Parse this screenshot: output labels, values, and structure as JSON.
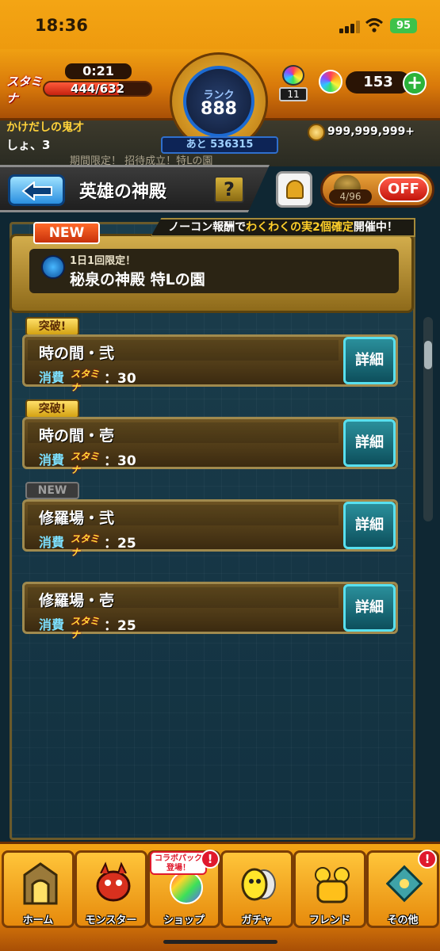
{
  "status_bar": {
    "time": "18:36",
    "battery": "95"
  },
  "hud": {
    "stamina_icon_label": "スタミナ",
    "stamina_timer": "0:21",
    "stamina_value": "444/632",
    "stamina_fraction": 0.7,
    "rank_label": "ランク",
    "rank_value": "888",
    "next_rank": "あと 536315",
    "small_orb_count": "11",
    "orb_count": "153",
    "add_symbol": "+"
  },
  "background_info": {
    "user_name": "かけだしの鬼才",
    "user_name_line2": "しょ、3",
    "coins": "999,999,999+",
    "ghost_text": "期間限定！ 招待成立！特Lの園"
  },
  "header": {
    "title": "英雄の神殿",
    "help_label": "?",
    "toggle_count": "4/96",
    "off_label": "OFF"
  },
  "event_ribbon": {
    "prefix": "ノーコン報酬で",
    "highlight": "わくわくの実2個確定",
    "suffix": "開催中！"
  },
  "featured": {
    "badge": "NEW",
    "subtitle": "1日1回限定！",
    "title": "秘泉の神殿 特Lの園"
  },
  "quests": [
    {
      "badge": "突破!",
      "name": "時の間・弐",
      "cost_label": "消費",
      "stamina_label": "スタミナ",
      "cost": "：30",
      "detail_label": "詳細"
    },
    {
      "badge": "突破!",
      "name": "時の間・壱",
      "cost_label": "消費",
      "stamina_label": "スタミナ",
      "cost": "：30",
      "detail_label": "詳細"
    },
    {
      "badge": "NEW",
      "name": "修羅場・弐",
      "cost_label": "消費",
      "stamina_label": "スタミナ",
      "cost": "：25",
      "detail_label": "詳細"
    },
    {
      "badge": "",
      "name": "修羅場・壱",
      "cost_label": "消費",
      "stamina_label": "スタミナ",
      "cost": "：25",
      "detail_label": "詳細"
    }
  ],
  "bottom_nav": [
    {
      "label": "ホーム"
    },
    {
      "label": "モンスター"
    },
    {
      "label": "ショップ",
      "tag": "コラボパック登場！"
    },
    {
      "label": "ガチャ"
    },
    {
      "label": "フレンド"
    },
    {
      "label": "その他"
    }
  ],
  "notif_symbol": "!",
  "colors": {
    "accent_orange": "#f4a514",
    "detail_teal": "#2a8f9b",
    "off_red": "#e0192d"
  }
}
